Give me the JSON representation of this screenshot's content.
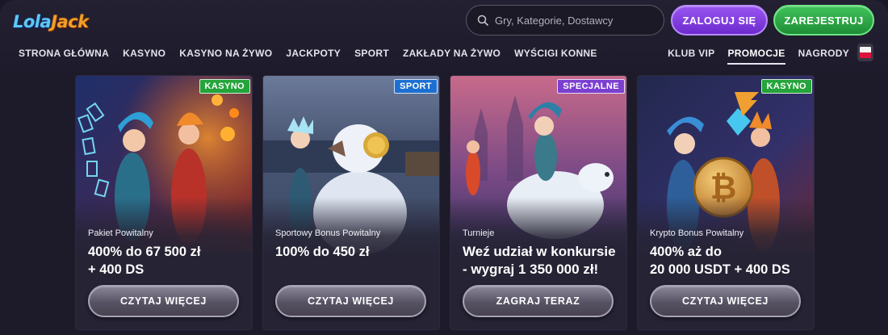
{
  "brand": {
    "logo_first": "Lola",
    "logo_second": "Jack"
  },
  "search": {
    "placeholder": "Gry, Kategorie, Dostawcy"
  },
  "auth": {
    "login_label": "ZALOGUJ SIĘ",
    "register_label": "ZAREJESTRUJ"
  },
  "nav": {
    "left": [
      "STRONA GŁÓWNA",
      "KASYNO",
      "KASYNO NA ŻYWO",
      "JACKPOTY",
      "SPORT",
      "ZAKŁADY NA ŻYWO",
      "WYŚCIGI KONNE"
    ],
    "right": [
      "KLUB VIP",
      "PROMOCJE",
      "NAGRODY"
    ],
    "active": "PROMOCJE"
  },
  "language": {
    "flag": "poland-flag-icon"
  },
  "cards": [
    {
      "badge": "KASYNO",
      "badge_color": "#24a43a",
      "subtitle": "Pakiet Powitalny",
      "title_line1": "400% do 67 500 zł",
      "title_line2": "+ 400 DS",
      "cta": "CZYTAJ WIĘCEJ"
    },
    {
      "badge": "SPORT",
      "badge_color": "#1d6fd1",
      "subtitle": "Sportowy Bonus Powitalny",
      "title_line1": "100% do 450 zł",
      "title_line2": "",
      "cta": "CZYTAJ WIĘCEJ"
    },
    {
      "badge": "SPECJALNE",
      "badge_color": "#7b3fd0",
      "subtitle": "Turnieje",
      "title_line1": "Weź udział w konkursie",
      "title_line2": "- wygraj 1 350 000 zł!",
      "cta": "ZAGRAJ TERAZ"
    },
    {
      "badge": "KASYNO",
      "badge_color": "#24a43a",
      "subtitle": "Krypto Bonus Powitalny",
      "title_line1": "400% aż do",
      "title_line2": "20 000 USDT + 400 DS",
      "cta": "CZYTAJ WIĘCEJ"
    }
  ]
}
